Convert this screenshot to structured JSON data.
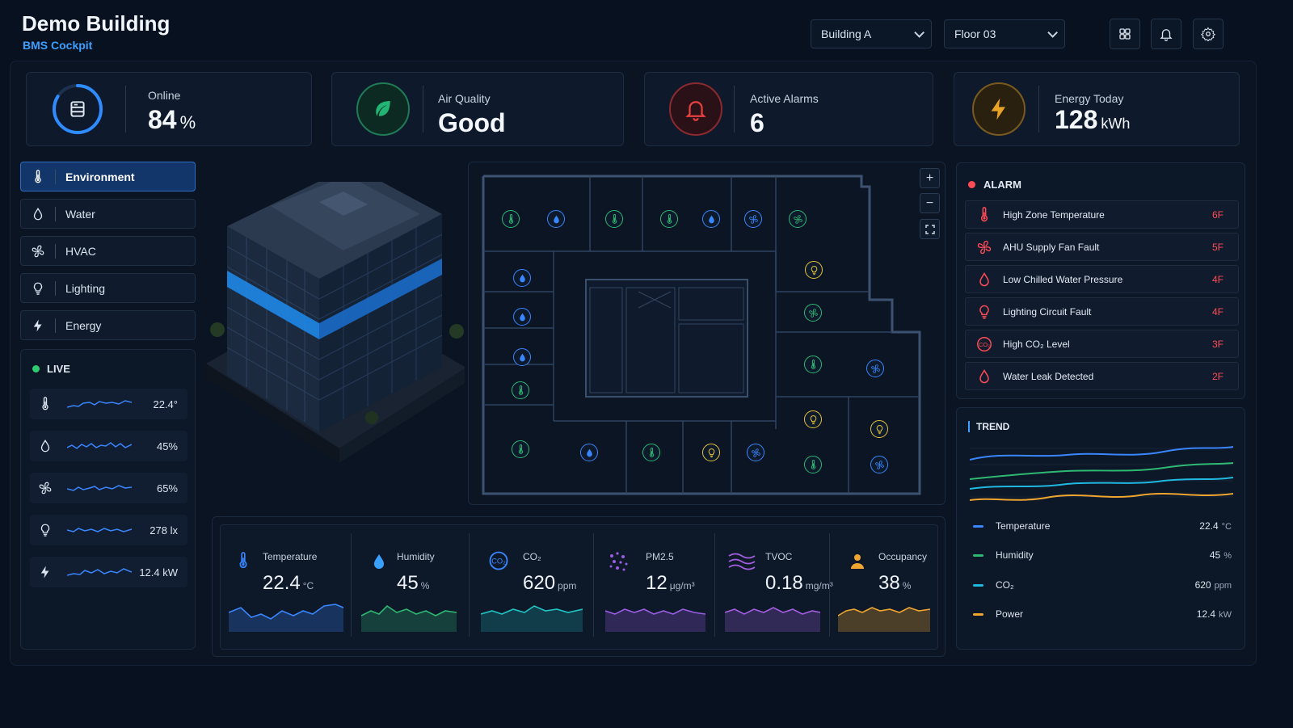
{
  "header": {
    "title": "Demo Building",
    "subtitle": "BMS Cockpit",
    "building_select": "Building A",
    "floor_select": "Floor 03",
    "icons": [
      "grid-icon",
      "bell-icon",
      "gear-icon"
    ]
  },
  "kpis": {
    "online": {
      "label": "Online",
      "value": "84",
      "unit": "%",
      "progress": 0.84,
      "color": "#2e8cff",
      "icon": "server-icon"
    },
    "air": {
      "label": "Air Quality",
      "value": "Good",
      "color": "#22b573",
      "icon": "leaf-icon"
    },
    "alarms": {
      "label": "Active Alarms",
      "value": "6",
      "color": "#e5413f",
      "icon": "bell-icon"
    },
    "energy": {
      "label": "Energy Today",
      "value": "128",
      "unit": "kWh",
      "color": "#e8a226",
      "icon": "bolt-icon"
    }
  },
  "nav": [
    {
      "label": "Environment",
      "icon": "thermometer-icon",
      "active": true
    },
    {
      "label": "Water",
      "icon": "droplet-icon"
    },
    {
      "label": "HVAC",
      "icon": "fan-icon"
    },
    {
      "label": "Lighting",
      "icon": "bulb-icon"
    },
    {
      "label": "Energy",
      "icon": "bolt-icon"
    }
  ],
  "live": {
    "title": "LIVE",
    "rows": [
      {
        "icon": "thermometer-icon",
        "value": "22.4°"
      },
      {
        "icon": "droplet-icon",
        "value": "45%"
      },
      {
        "icon": "fan-icon",
        "value": "65%"
      },
      {
        "icon": "bulb-icon",
        "value": "278 lx"
      },
      {
        "icon": "bolt-icon",
        "value": "12.4 kW"
      }
    ]
  },
  "sensors": [
    {
      "label": "Temperature",
      "value": "22.4",
      "unit": "°C",
      "color": "#3a86ff",
      "icon": "thermometer-icon"
    },
    {
      "label": "Humidity",
      "value": "45",
      "unit": "%",
      "color": "#2eb872",
      "icon": "droplet-icon"
    },
    {
      "label": "CO₂",
      "value": "620",
      "unit": "ppm",
      "color": "#21c4c4",
      "icon": "co2-icon"
    },
    {
      "label": "PM2.5",
      "value": "12",
      "unit": "μg/m³",
      "color": "#9b5de5",
      "icon": "particles-icon"
    },
    {
      "label": "TVOC",
      "value": "0.18",
      "unit": "mg/m³",
      "color": "#a45ee0",
      "icon": "waves-icon"
    },
    {
      "label": "Occupancy",
      "value": "38",
      "unit": "%",
      "color": "#f0a530",
      "icon": "person-icon"
    }
  ],
  "alarm": {
    "title": "ALARM",
    "items": [
      {
        "label": "High Zone Temperature",
        "floor": "6F",
        "icon": "thermometer-icon"
      },
      {
        "label": "AHU Supply Fan Fault",
        "floor": "5F",
        "icon": "fan-icon"
      },
      {
        "label": "Low Chilled Water Pressure",
        "floor": "4F",
        "icon": "droplet-icon"
      },
      {
        "label": "Lighting Circuit Fault",
        "floor": "4F",
        "icon": "bulb-icon"
      },
      {
        "label": "High CO₂ Level",
        "floor": "3F",
        "icon": "co2-icon"
      },
      {
        "label": "Water Leak Detected",
        "floor": "2F",
        "icon": "droplet-icon"
      }
    ]
  },
  "trend": {
    "title": "TREND",
    "rows": [
      {
        "label": "Temperature",
        "value": "22.4",
        "unit": "°C",
        "color": "#3a86ff"
      },
      {
        "label": "Humidity",
        "value": "45",
        "unit": "%",
        "color": "#2eb872"
      },
      {
        "label": "CO₂",
        "value": "620",
        "unit": "ppm",
        "color": "#21b8e0"
      },
      {
        "label": "Power",
        "value": "12.4",
        "unit": "kW",
        "color": "#f0a530"
      }
    ]
  },
  "floorplan": {
    "zoom_in": "+",
    "zoom_out": "−"
  }
}
